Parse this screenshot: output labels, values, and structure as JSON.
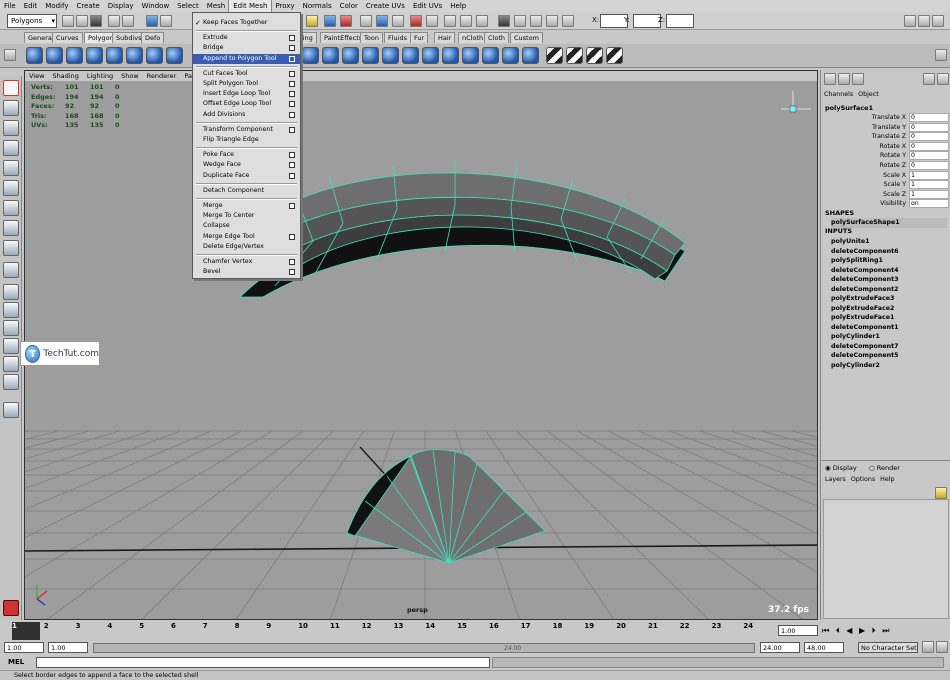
{
  "menubar": [
    "File",
    "Edit",
    "Modify",
    "Create",
    "Display",
    "Window",
    "Select",
    "Mesh",
    "Edit Mesh",
    "Proxy",
    "Normals",
    "Color",
    "Create UVs",
    "Edit UVs",
    "Help"
  ],
  "status_line": {
    "mode": "Polygons",
    "coord_labels": [
      "X:",
      "Y:",
      "Z:"
    ]
  },
  "shelf_tabs": [
    "General",
    "Curves",
    "Polygons",
    "Subdivs",
    "Defo",
    "",
    "",
    "ering",
    "PaintEffects",
    "Toon",
    "Fluids",
    "Fur",
    "Hair",
    "nCloth",
    "Cloth",
    "Custom"
  ],
  "active_shelf_tab": "Polygons",
  "edit_mesh_menu": [
    {
      "label": "Keep Faces Together",
      "check": true
    },
    {
      "sep": true
    },
    {
      "label": "Extrude",
      "option": true
    },
    {
      "label": "Bridge",
      "option": true
    },
    {
      "label": "Append to Polygon Tool",
      "option": true,
      "highlight": true
    },
    {
      "sep": true
    },
    {
      "label": "Cut Faces Tool",
      "option": true
    },
    {
      "label": "Split Polygon Tool",
      "option": true
    },
    {
      "label": "Insert Edge Loop Tool",
      "option": true
    },
    {
      "label": "Offset Edge Loop Tool",
      "option": true
    },
    {
      "label": "Add Divisions",
      "option": true
    },
    {
      "sep": true
    },
    {
      "label": "Transform Component",
      "option": true
    },
    {
      "label": "Flip Triangle Edge"
    },
    {
      "sep": true
    },
    {
      "label": "Poke Face",
      "option": true
    },
    {
      "label": "Wedge Face",
      "option": true
    },
    {
      "label": "Duplicate Face",
      "option": true
    },
    {
      "sep": true
    },
    {
      "label": "Detach Component"
    },
    {
      "sep": true
    },
    {
      "label": "Merge",
      "option": true
    },
    {
      "label": "Merge To Center"
    },
    {
      "label": "Collapse"
    },
    {
      "label": "Merge Edge Tool",
      "option": true
    },
    {
      "label": "Delete Edge/Vertex"
    },
    {
      "sep": true
    },
    {
      "label": "Chamfer Vertex",
      "option": true
    },
    {
      "label": "Bevel",
      "option": true
    }
  ],
  "panel_menu": [
    "View",
    "Shading",
    "Lighting",
    "Show",
    "Renderer",
    "Panels"
  ],
  "hud": [
    {
      "label": "Verts:",
      "a": "101",
      "b": "101",
      "c": "0"
    },
    {
      "label": "Edges:",
      "a": "194",
      "b": "194",
      "c": "0"
    },
    {
      "label": "Faces:",
      "a": "92",
      "b": "92",
      "c": "0"
    },
    {
      "label": "Tris:",
      "a": "168",
      "b": "168",
      "c": "0"
    },
    {
      "label": "UVs:",
      "a": "135",
      "b": "135",
      "c": "0"
    }
  ],
  "camera_label": "persp",
  "fps": "37.2 fps",
  "watermark": {
    "logo": "T",
    "text": "TechTut.com"
  },
  "channel_box": {
    "tabs": [
      "Channels",
      "Object"
    ],
    "object": "polySurface1",
    "attributes": [
      {
        "name": "Translate X",
        "value": "0"
      },
      {
        "name": "Translate Y",
        "value": "0"
      },
      {
        "name": "Translate Z",
        "value": "0"
      },
      {
        "name": "Rotate X",
        "value": "0"
      },
      {
        "name": "Rotate Y",
        "value": "0"
      },
      {
        "name": "Rotate Z",
        "value": "0"
      },
      {
        "name": "Scale X",
        "value": "1"
      },
      {
        "name": "Scale Y",
        "value": "1"
      },
      {
        "name": "Scale Z",
        "value": "1"
      },
      {
        "name": "Visibility",
        "value": "on"
      }
    ],
    "shapes_header": "SHAPES",
    "shape": "polySurfaceShape1",
    "inputs_header": "INPUTS",
    "inputs": [
      "polyUnite1",
      "deleteComponent6",
      "polySplitRing1",
      "deleteComponent4",
      "deleteComponent3",
      "deleteComponent2",
      "polyExtrudeFace3",
      "polyExtrudeFace2",
      "polyExtrudeFace1",
      "deleteComponent1",
      "polyCylinder1",
      "deleteComponent7",
      "deleteComponent5",
      "polyCylinder2"
    ]
  },
  "layer_editor": {
    "display": "Display",
    "render": "Render",
    "menu": [
      "Layers",
      "Options",
      "Help"
    ]
  },
  "time_slider": {
    "ticks": [
      "1",
      "2",
      "3",
      "4",
      "5",
      "6",
      "7",
      "8",
      "9",
      "10",
      "11",
      "12",
      "13",
      "14",
      "15",
      "16",
      "17",
      "18",
      "19",
      "20",
      "21",
      "22",
      "23",
      "24"
    ],
    "current_frame": "1.00"
  },
  "range_slider": {
    "start": "1.00",
    "range_start": "1.00",
    "range_end_label": "24.00",
    "end": "24.00",
    "anim_end": "48.00",
    "char_set": "No Character Set"
  },
  "command_line": {
    "label": "MEL"
  },
  "help_line": "Select border edges to append a face to the selected shell"
}
